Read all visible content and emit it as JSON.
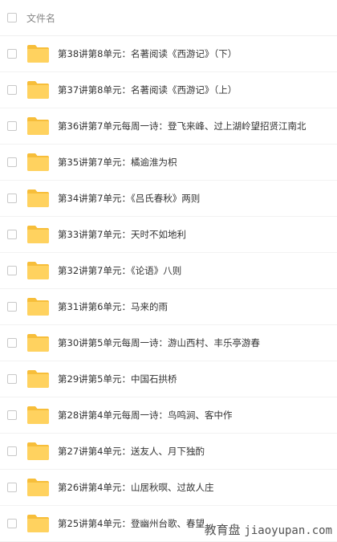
{
  "header": {
    "column_label": "文件名"
  },
  "files": [
    {
      "name": "第38讲第8单元：名著阅读《西游记》（下）",
      "icon": "folder-icon"
    },
    {
      "name": "第37讲第8单元：名著阅读《西游记》（上）",
      "icon": "folder-icon"
    },
    {
      "name": "第36讲第7单元每周一诗：登飞来峰、过上湖岭望招贤江南北",
      "icon": "folder-icon"
    },
    {
      "name": "第35讲第7单元：橘逾淮为枳",
      "icon": "folder-icon"
    },
    {
      "name": "第34讲第7单元：《吕氏春秋》两则",
      "icon": "folder-icon"
    },
    {
      "name": "第33讲第7单元：天时不如地利",
      "icon": "folder-icon"
    },
    {
      "name": "第32讲第7单元：《论语》八则",
      "icon": "folder-icon"
    },
    {
      "name": "第31讲第6单元：马来的雨",
      "icon": "folder-icon"
    },
    {
      "name": "第30讲第5单元每周一诗：游山西村、丰乐亭游春",
      "icon": "folder-icon"
    },
    {
      "name": "第29讲第5单元：中国石拱桥",
      "icon": "folder-icon"
    },
    {
      "name": "第28讲第4单元每周一诗：鸟鸣涧、客中作",
      "icon": "folder-icon"
    },
    {
      "name": "第27讲第4单元：送友人、月下独酌",
      "icon": "folder-icon"
    },
    {
      "name": "第26讲第4单元：山居秋暝、过故人庄",
      "icon": "folder-icon"
    },
    {
      "name": "第25讲第4单元：登幽州台歌、春望",
      "icon": "folder-icon"
    }
  ],
  "watermark": {
    "cn": "教育盘",
    "en": "jiaoyupan.com"
  },
  "colors": {
    "folder": "#FFD25F",
    "folder_back": "#F7BE3A"
  }
}
